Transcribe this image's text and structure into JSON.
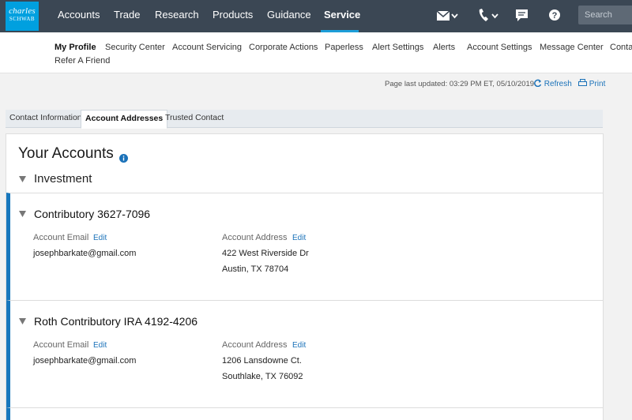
{
  "brand": {
    "logo_line1": "charles",
    "logo_line2": "SCHWAB",
    "accent": "#00a0df"
  },
  "topnav": {
    "items": [
      "Accounts",
      "Trade",
      "Research",
      "Products",
      "Guidance",
      "Service"
    ],
    "active": "Service",
    "icons": [
      "mail-icon",
      "phone-icon",
      "chat-icon",
      "help-icon"
    ],
    "search_placeholder": "Search"
  },
  "subnav": {
    "items": [
      "My Profile",
      "Security Center",
      "Account Servicing",
      "Corporate Actions",
      "Paperless",
      "Alert Settings",
      "Alerts",
      "Account Settings",
      "Message Center",
      "Contac"
    ],
    "row2": "Refer A Friend"
  },
  "page": {
    "updated": "Page last updated: 03:29 PM ET, 05/10/2019",
    "refresh": "Refresh",
    "print": "Print"
  },
  "tabs": [
    "Contact Information",
    "Account Addresses",
    "Trusted Contact"
  ],
  "main": {
    "title": "Your Accounts",
    "group": "Investment",
    "accounts": [
      {
        "name": "Contributory 3627-7096",
        "email_label": "Account Email",
        "email_edit": "Edit",
        "email": "josephbarkate@gmail.com",
        "address_label": "Account Address",
        "address_edit": "Edit",
        "address_line1": "422 West Riverside Dr",
        "address_line2": "Austin, TX 78704"
      },
      {
        "name": "Roth Contributory IRA 4192-4206",
        "email_label": "Account Email",
        "email_edit": "Edit",
        "email": "josephbarkate@gmail.com",
        "address_label": "Account Address",
        "address_edit": "Edit",
        "address_line1": "1206 Lansdowne Ct.",
        "address_line2": "Southlake, TX 76092"
      }
    ]
  }
}
